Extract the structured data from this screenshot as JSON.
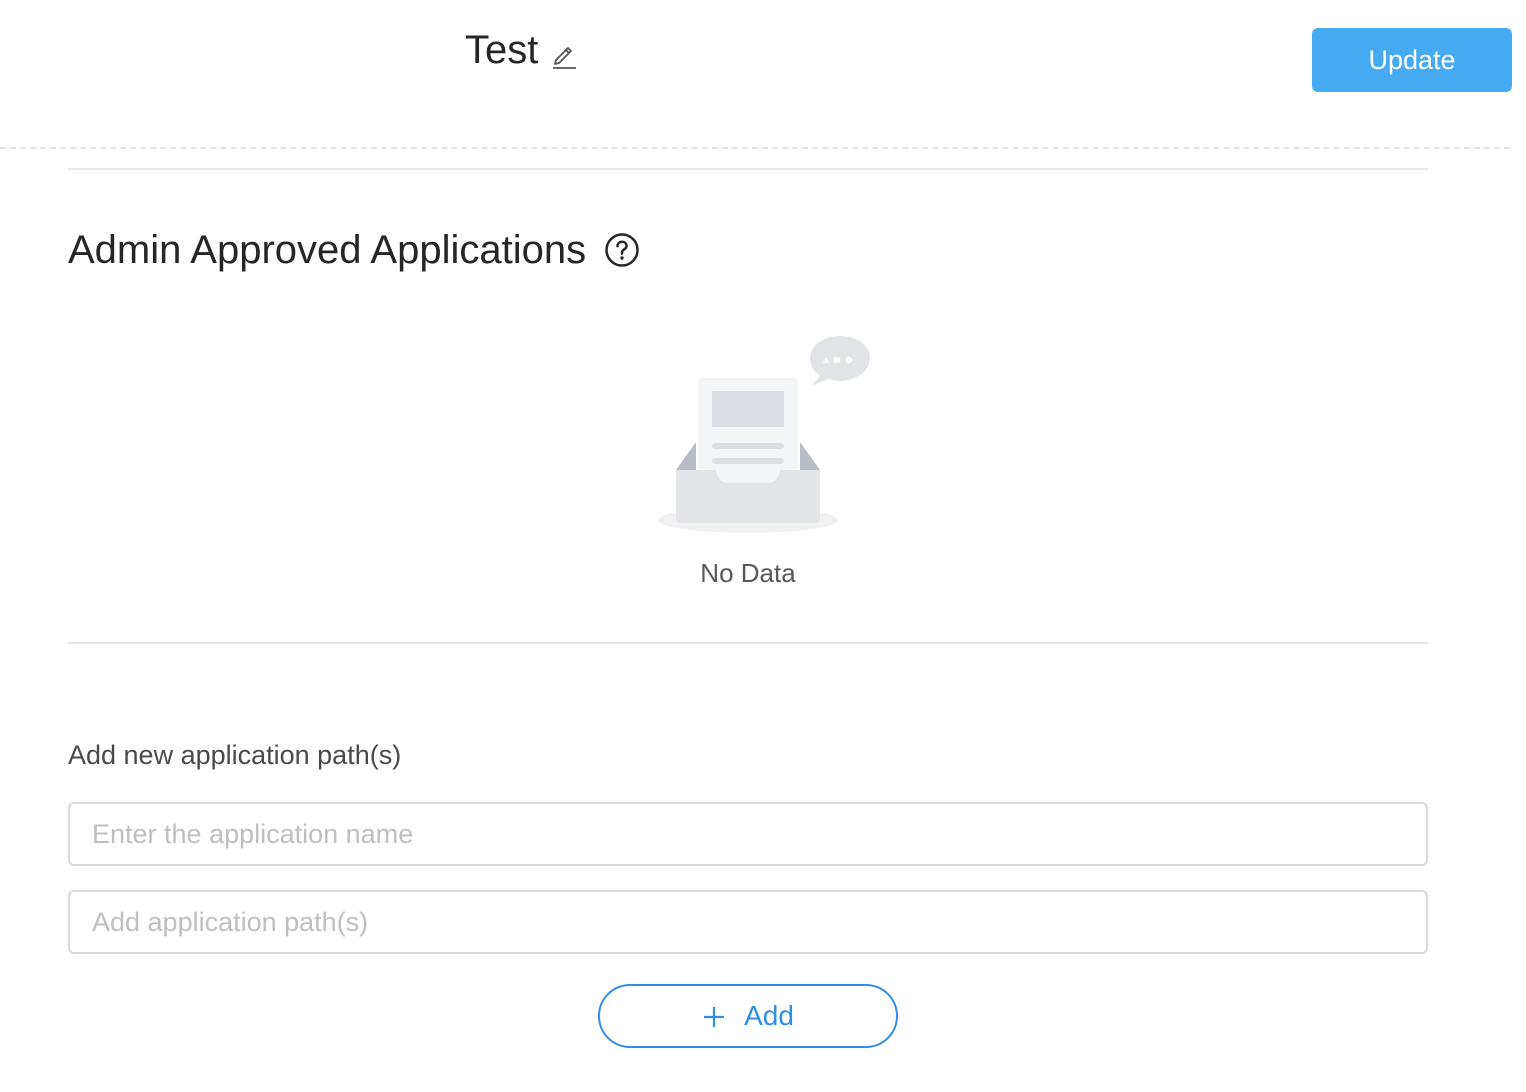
{
  "header": {
    "title": "Test",
    "update_label": "Update"
  },
  "section": {
    "title": "Admin Approved Applications"
  },
  "empty_state": {
    "text": "No Data"
  },
  "form": {
    "label": "Add new application path(s)",
    "name_placeholder": "Enter the application name",
    "name_value": "",
    "path_placeholder": "Add application path(s)",
    "path_value": "",
    "add_label": "Add"
  },
  "colors": {
    "primary_button": "#45aaf2",
    "add_button_accent": "#2f8fe8",
    "divider": "#e8e8e8"
  },
  "icons": {
    "edit": "pencil-edit-icon",
    "help": "question-circle-icon",
    "add": "plus-icon",
    "empty": "empty-inbox-illustration"
  }
}
